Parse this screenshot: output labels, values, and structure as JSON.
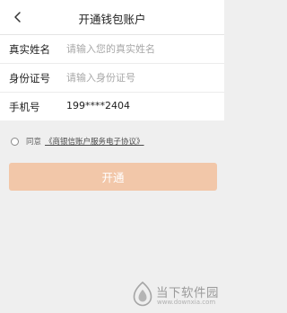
{
  "header": {
    "title": "开通钱包账户",
    "back_icon": "chevron-left-icon"
  },
  "form": {
    "name": {
      "label": "真实姓名",
      "placeholder": "请输入您的真实姓名"
    },
    "id_number": {
      "label": "身份证号",
      "placeholder": "请输入身份证号"
    },
    "phone": {
      "label": "手机号",
      "value": "199****2404"
    }
  },
  "agreement": {
    "prefix": "同意",
    "link": "《商银信账户服务电子协议》"
  },
  "submit": {
    "label": "开通",
    "color": "#f2c7a9"
  },
  "watermark": {
    "name": "当下软件园",
    "url": "www.downxia.com"
  }
}
